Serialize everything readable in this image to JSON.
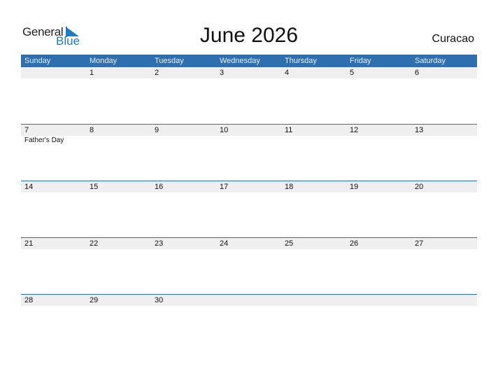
{
  "logo": {
    "word1": "General",
    "word2": "Blue"
  },
  "header": {
    "title": "June 2026",
    "country": "Curacao"
  },
  "colors": {
    "accent": "#2e6fb0",
    "row_bg": "#efefef",
    "logo_blue": "#1e7bc4"
  },
  "weekdays": [
    "Sunday",
    "Monday",
    "Tuesday",
    "Wednesday",
    "Thursday",
    "Friday",
    "Saturday"
  ],
  "weeks": [
    {
      "days": [
        "",
        "1",
        "2",
        "3",
        "4",
        "5",
        "6"
      ],
      "events": [
        "",
        "",
        "",
        "",
        "",
        "",
        ""
      ]
    },
    {
      "days": [
        "7",
        "8",
        "9",
        "10",
        "11",
        "12",
        "13"
      ],
      "events": [
        "Father's Day",
        "",
        "",
        "",
        "",
        "",
        ""
      ]
    },
    {
      "days": [
        "14",
        "15",
        "16",
        "17",
        "18",
        "19",
        "20"
      ],
      "events": [
        "",
        "",
        "",
        "",
        "",
        "",
        ""
      ]
    },
    {
      "days": [
        "21",
        "22",
        "23",
        "24",
        "25",
        "26",
        "27"
      ],
      "events": [
        "",
        "",
        "",
        "",
        "",
        "",
        ""
      ]
    },
    {
      "days": [
        "28",
        "29",
        "30",
        "",
        "",
        "",
        ""
      ],
      "events": [
        "",
        "",
        "",
        "",
        "",
        "",
        ""
      ]
    }
  ]
}
